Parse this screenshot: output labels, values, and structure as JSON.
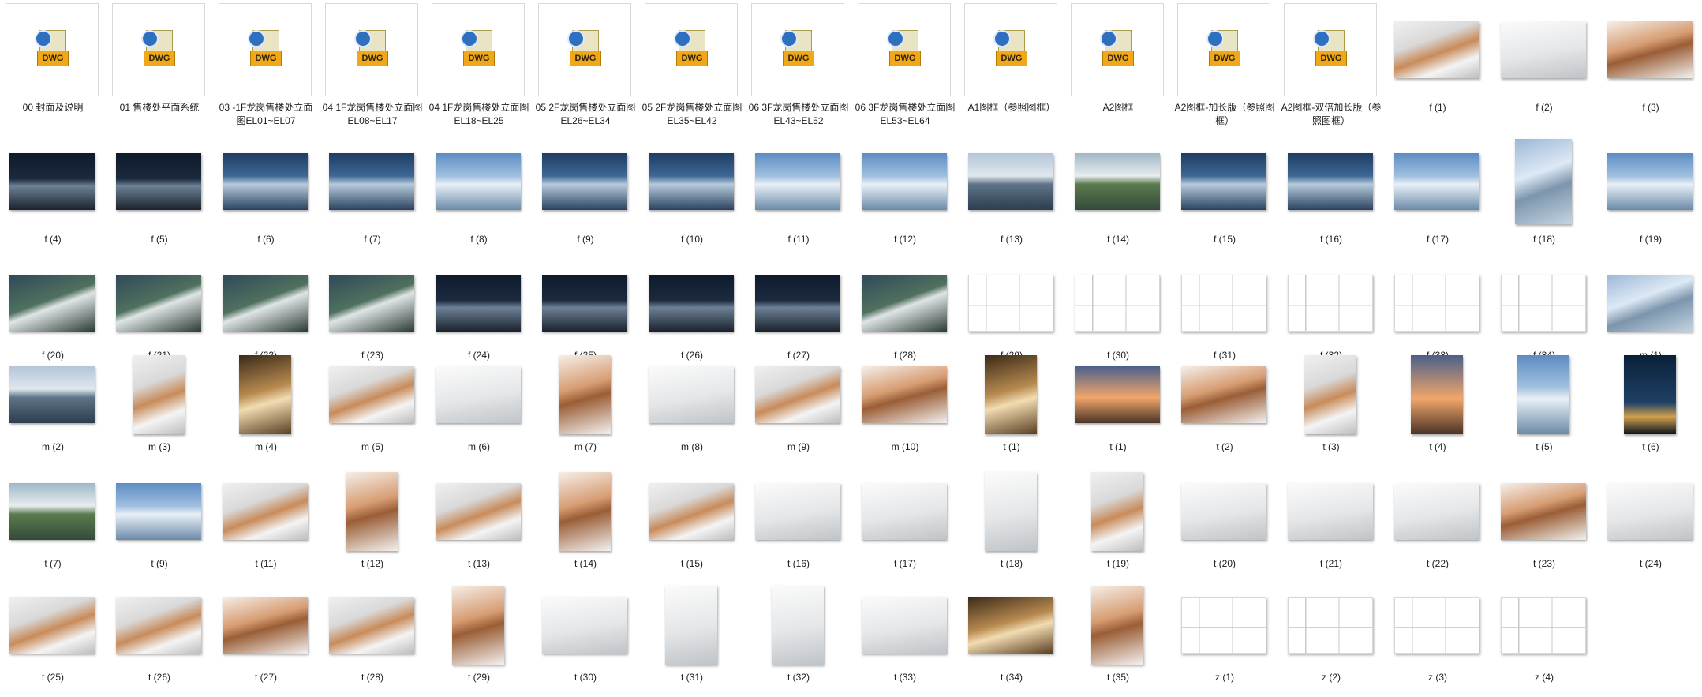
{
  "items": [
    {
      "label": "00 封面及说明",
      "kind": "dwg",
      "icon": "dwg-file-icon"
    },
    {
      "label": "01 售楼处平面系统",
      "kind": "dwg",
      "icon": "dwg-file-icon"
    },
    {
      "label": "03 -1F龙岗售楼处立面图EL01~EL07",
      "kind": "dwg",
      "icon": "dwg-file-icon"
    },
    {
      "label": "04 1F龙岗售楼处立面图EL08~EL17",
      "kind": "dwg",
      "icon": "dwg-file-icon"
    },
    {
      "label": "04 1F龙岗售楼处立面图EL18~EL25",
      "kind": "dwg",
      "icon": "dwg-file-icon"
    },
    {
      "label": "05 2F龙岗售楼处立面图EL26~EL34",
      "kind": "dwg",
      "icon": "dwg-file-icon"
    },
    {
      "label": "05 2F龙岗售楼处立面图EL35~EL42",
      "kind": "dwg",
      "icon": "dwg-file-icon"
    },
    {
      "label": "06 3F龙岗售楼处立面图EL43~EL52",
      "kind": "dwg",
      "icon": "dwg-file-icon"
    },
    {
      "label": "06 3F龙岗售楼处立面图EL53~EL64",
      "kind": "dwg",
      "icon": "dwg-file-icon"
    },
    {
      "label": "A1图框（参照图框）",
      "kind": "dwg",
      "icon": "dwg-file-icon"
    },
    {
      "label": "A2图框",
      "kind": "dwg",
      "icon": "dwg-file-icon"
    },
    {
      "label": "A2图框-加长版（参照图框）",
      "kind": "dwg",
      "icon": "dwg-file-icon"
    },
    {
      "label": "A2图框-双倍加长版（参照图框）",
      "kind": "dwg",
      "icon": "dwg-file-icon"
    },
    {
      "label": "f (1)",
      "kind": "photo",
      "orient": "land",
      "style": "interior"
    },
    {
      "label": "f (2)",
      "kind": "photo",
      "orient": "land",
      "style": "whiteint"
    },
    {
      "label": "f (3)",
      "kind": "photo",
      "orient": "land",
      "style": "copper"
    },
    {
      "label": "f (4)",
      "kind": "photo",
      "orient": "land",
      "style": "night"
    },
    {
      "label": "f (5)",
      "kind": "photo",
      "orient": "land",
      "style": "night"
    },
    {
      "label": "f (6)",
      "kind": "photo",
      "orient": "land",
      "style": "dusk"
    },
    {
      "label": "f (7)",
      "kind": "photo",
      "orient": "land",
      "style": "dusk"
    },
    {
      "label": "f (8)",
      "kind": "photo",
      "orient": "land",
      "style": "sky"
    },
    {
      "label": "f (9)",
      "kind": "photo",
      "orient": "land",
      "style": "dusk"
    },
    {
      "label": "f (10)",
      "kind": "photo",
      "orient": "land",
      "style": "dusk"
    },
    {
      "label": "f (11)",
      "kind": "photo",
      "orient": "land",
      "style": "sky"
    },
    {
      "label": "f (12)",
      "kind": "photo",
      "orient": "land",
      "style": "sky"
    },
    {
      "label": "f (13)",
      "kind": "photo",
      "orient": "land",
      "style": "lake"
    },
    {
      "label": "f (14)",
      "kind": "photo",
      "orient": "land",
      "style": "green"
    },
    {
      "label": "f (15)",
      "kind": "photo",
      "orient": "land",
      "style": "dusk"
    },
    {
      "label": "f (16)",
      "kind": "photo",
      "orient": "land",
      "style": "dusk"
    },
    {
      "label": "f (17)",
      "kind": "photo",
      "orient": "land",
      "style": "sky"
    },
    {
      "label": "f (18)",
      "kind": "photo",
      "orient": "port",
      "style": "glass"
    },
    {
      "label": "f (19)",
      "kind": "photo",
      "orient": "land",
      "style": "sky"
    },
    {
      "label": "f (20)",
      "kind": "photo",
      "orient": "land",
      "style": "aerial"
    },
    {
      "label": "f (21)",
      "kind": "photo",
      "orient": "land",
      "style": "aerial"
    },
    {
      "label": "f (22)",
      "kind": "photo",
      "orient": "land",
      "style": "aerial"
    },
    {
      "label": "f (23)",
      "kind": "photo",
      "orient": "land",
      "style": "aerial"
    },
    {
      "label": "f (24)",
      "kind": "photo",
      "orient": "land",
      "style": "night"
    },
    {
      "label": "f (25)",
      "kind": "photo",
      "orient": "land",
      "style": "night"
    },
    {
      "label": "f (26)",
      "kind": "photo",
      "orient": "land",
      "style": "night"
    },
    {
      "label": "f (27)",
      "kind": "photo",
      "orient": "land",
      "style": "night"
    },
    {
      "label": "f (28)",
      "kind": "photo",
      "orient": "land",
      "style": "aerial"
    },
    {
      "label": "f (29)",
      "kind": "photo",
      "orient": "land",
      "style": "drawing"
    },
    {
      "label": "f (30)",
      "kind": "photo",
      "orient": "land",
      "style": "drawing"
    },
    {
      "label": "f (31)",
      "kind": "photo",
      "orient": "land",
      "style": "drawing"
    },
    {
      "label": "f (32)",
      "kind": "photo",
      "orient": "land",
      "style": "drawing"
    },
    {
      "label": "f (33)",
      "kind": "photo",
      "orient": "land",
      "style": "drawing"
    },
    {
      "label": "f (34)",
      "kind": "photo",
      "orient": "land",
      "style": "drawing"
    },
    {
      "label": "m (1)",
      "kind": "photo",
      "orient": "land",
      "style": "glass"
    },
    {
      "label": "m (2)",
      "kind": "photo",
      "orient": "land",
      "style": "lake"
    },
    {
      "label": "m (3)",
      "kind": "photo",
      "orient": "port",
      "style": "interior"
    },
    {
      "label": "m (4)",
      "kind": "photo",
      "orient": "port",
      "style": "gold"
    },
    {
      "label": "m (5)",
      "kind": "photo",
      "orient": "land",
      "style": "interior"
    },
    {
      "label": "m (6)",
      "kind": "photo",
      "orient": "land",
      "style": "whiteint"
    },
    {
      "label": "m (7)",
      "kind": "photo",
      "orient": "port",
      "style": "copper"
    },
    {
      "label": "m (8)",
      "kind": "photo",
      "orient": "land",
      "style": "whiteint"
    },
    {
      "label": "m (9)",
      "kind": "photo",
      "orient": "land",
      "style": "interior"
    },
    {
      "label": "m (10)",
      "kind": "photo",
      "orient": "land",
      "style": "copper"
    },
    {
      "label": "t (1)",
      "kind": "photo",
      "orient": "port",
      "style": "gold"
    },
    {
      "label": "t (1)",
      "kind": "photo",
      "orient": "land",
      "style": "tower"
    },
    {
      "label": "t (2)",
      "kind": "photo",
      "orient": "land",
      "style": "copper"
    },
    {
      "label": "t (3)",
      "kind": "photo",
      "orient": "port",
      "style": "interior"
    },
    {
      "label": "t (4)",
      "kind": "photo",
      "orient": "port",
      "style": "tower"
    },
    {
      "label": "t (5)",
      "kind": "photo",
      "orient": "port",
      "style": "sky"
    },
    {
      "label": "t (6)",
      "kind": "photo",
      "orient": "port",
      "style": "bluetower"
    },
    {
      "label": "t (7)",
      "kind": "photo",
      "orient": "land",
      "style": "green"
    },
    {
      "label": "t (9)",
      "kind": "photo",
      "orient": "land",
      "style": "sky"
    },
    {
      "label": "t (11)",
      "kind": "photo",
      "orient": "land",
      "style": "interior"
    },
    {
      "label": "t (12)",
      "kind": "photo",
      "orient": "port",
      "style": "copper"
    },
    {
      "label": "t (13)",
      "kind": "photo",
      "orient": "land",
      "style": "interior"
    },
    {
      "label": "t (14)",
      "kind": "photo",
      "orient": "port",
      "style": "copper"
    },
    {
      "label": "t (15)",
      "kind": "photo",
      "orient": "land",
      "style": "interior"
    },
    {
      "label": "t (16)",
      "kind": "photo",
      "orient": "land",
      "style": "whiteint"
    },
    {
      "label": "t (17)",
      "kind": "photo",
      "orient": "land",
      "style": "whiteint"
    },
    {
      "label": "t (18)",
      "kind": "photo",
      "orient": "port",
      "style": "whiteint"
    },
    {
      "label": "t (19)",
      "kind": "photo",
      "orient": "port",
      "style": "interior"
    },
    {
      "label": "t (20)",
      "kind": "photo",
      "orient": "land",
      "style": "whiteint"
    },
    {
      "label": "t (21)",
      "kind": "photo",
      "orient": "land",
      "style": "whiteint"
    },
    {
      "label": "t (22)",
      "kind": "photo",
      "orient": "land",
      "style": "whiteint"
    },
    {
      "label": "t (23)",
      "kind": "photo",
      "orient": "land",
      "style": "copper"
    },
    {
      "label": "t (24)",
      "kind": "photo",
      "orient": "land",
      "style": "whiteint"
    },
    {
      "label": "t (25)",
      "kind": "photo",
      "orient": "land",
      "style": "interior"
    },
    {
      "label": "t (26)",
      "kind": "photo",
      "orient": "land",
      "style": "interior"
    },
    {
      "label": "t (27)",
      "kind": "photo",
      "orient": "land",
      "style": "copper"
    },
    {
      "label": "t (28)",
      "kind": "photo",
      "orient": "land",
      "style": "interior"
    },
    {
      "label": "t (29)",
      "kind": "photo",
      "orient": "port",
      "style": "copper"
    },
    {
      "label": "t (30)",
      "kind": "photo",
      "orient": "land",
      "style": "whiteint"
    },
    {
      "label": "t (31)",
      "kind": "photo",
      "orient": "port",
      "style": "whiteint"
    },
    {
      "label": "t (32)",
      "kind": "photo",
      "orient": "port",
      "style": "whiteint"
    },
    {
      "label": "t (33)",
      "kind": "photo",
      "orient": "land",
      "style": "whiteint"
    },
    {
      "label": "t (34)",
      "kind": "photo",
      "orient": "land",
      "style": "gold"
    },
    {
      "label": "t (35)",
      "kind": "photo",
      "orient": "port",
      "style": "copper"
    },
    {
      "label": "z (1)",
      "kind": "photo",
      "orient": "land",
      "style": "drawing"
    },
    {
      "label": "z (2)",
      "kind": "photo",
      "orient": "land",
      "style": "drawing"
    },
    {
      "label": "z (3)",
      "kind": "photo",
      "orient": "land",
      "style": "drawing"
    },
    {
      "label": "z (4)",
      "kind": "photo",
      "orient": "land",
      "style": "drawing"
    }
  ],
  "dwg_badge": "DWG"
}
